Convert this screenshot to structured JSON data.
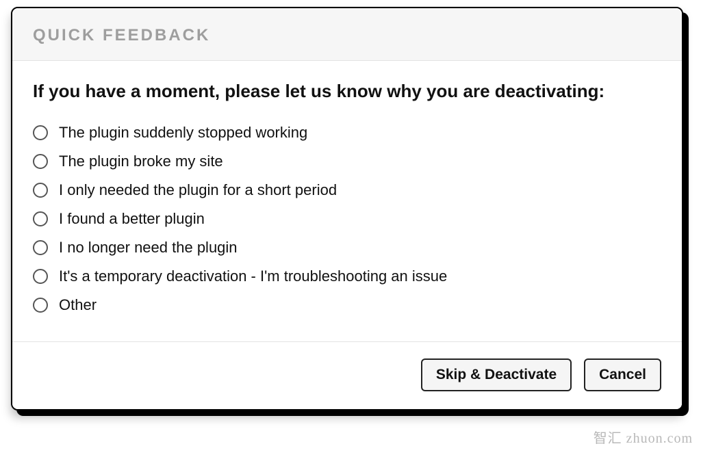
{
  "modal": {
    "header_title": "QUICK FEEDBACK",
    "question": "If you have a moment, please let us know why you are deactivating:",
    "options": [
      "The plugin suddenly stopped working",
      "The plugin broke my site",
      "I only needed the plugin for a short period",
      "I found a better plugin",
      "I no longer need the plugin",
      "It's a temporary deactivation - I'm troubleshooting an issue",
      "Other"
    ],
    "buttons": {
      "skip": "Skip & Deactivate",
      "cancel": "Cancel"
    }
  },
  "watermark": "智汇 zhuon.com"
}
